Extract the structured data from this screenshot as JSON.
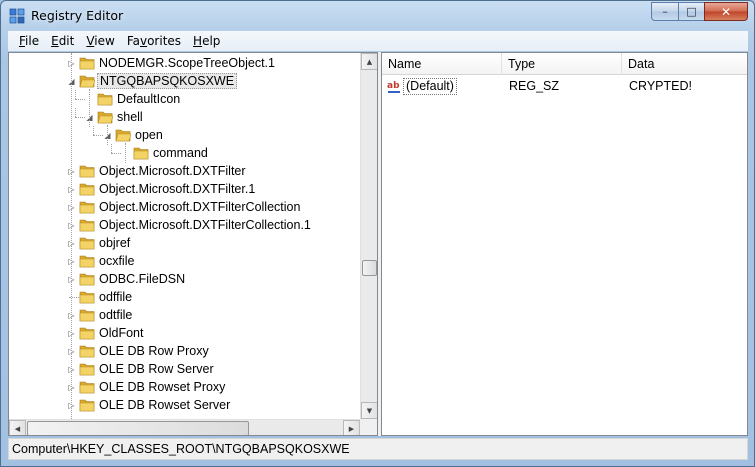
{
  "window": {
    "title": "Registry Editor",
    "icon": "registry-editor-icon",
    "buttons": {
      "minimize": "–",
      "maximize": "□",
      "close": "✕"
    }
  },
  "menu": [
    {
      "label_u": "F",
      "label_rest": "ile"
    },
    {
      "label_u": "E",
      "label_rest": "dit"
    },
    {
      "label_u": "V",
      "label_rest": "iew"
    },
    {
      "label_u": "F",
      "label_rest": "avorites",
      "prefix": "Fa",
      "u2": "v",
      "rest2": "orites"
    },
    {
      "label_u": "H",
      "label_rest": "elp"
    }
  ],
  "menu_labels": [
    "File",
    "Edit",
    "View",
    "Favorites",
    "Help"
  ],
  "tree": {
    "rows": [
      {
        "label": "NODEMGR.ScopeTreeObject.1",
        "level": 0,
        "expander": "collapsed"
      },
      {
        "label": "NTGQBAPSQKOSXWE",
        "level": 0,
        "expander": "expanded",
        "selected": true
      },
      {
        "label": "DefaultIcon",
        "level": 1,
        "expander": "none"
      },
      {
        "label": "shell",
        "level": 1,
        "expander": "expanded"
      },
      {
        "label": "open",
        "level": 2,
        "expander": "expanded"
      },
      {
        "label": "command",
        "level": 3,
        "expander": "none"
      },
      {
        "label": "Object.Microsoft.DXTFilter",
        "level": 0,
        "expander": "collapsed"
      },
      {
        "label": "Object.Microsoft.DXTFilter.1",
        "level": 0,
        "expander": "collapsed"
      },
      {
        "label": "Object.Microsoft.DXTFilterCollection",
        "level": 0,
        "expander": "collapsed"
      },
      {
        "label": "Object.Microsoft.DXTFilterCollection.1",
        "level": 0,
        "expander": "collapsed"
      },
      {
        "label": "objref",
        "level": 0,
        "expander": "collapsed"
      },
      {
        "label": "ocxfile",
        "level": 0,
        "expander": "collapsed"
      },
      {
        "label": "ODBC.FileDSN",
        "level": 0,
        "expander": "collapsed"
      },
      {
        "label": "odffile",
        "level": 0,
        "expander": "none"
      },
      {
        "label": "odtfile",
        "level": 0,
        "expander": "collapsed"
      },
      {
        "label": "OldFont",
        "level": 0,
        "expander": "collapsed"
      },
      {
        "label": "OLE DB Row Proxy",
        "level": 0,
        "expander": "collapsed"
      },
      {
        "label": "OLE DB Row Server",
        "level": 0,
        "expander": "collapsed"
      },
      {
        "label": "OLE DB Rowset Proxy",
        "level": 0,
        "expander": "collapsed"
      },
      {
        "label": "OLE DB Rowset Server",
        "level": 0,
        "expander": "collapsed"
      }
    ]
  },
  "list": {
    "columns": [
      "Name",
      "Type",
      "Data"
    ],
    "rows": [
      {
        "name": "(Default)",
        "type": "REG_SZ",
        "data": "CRYPTED!",
        "icon": "string-value-icon"
      }
    ]
  },
  "status": {
    "path": "Computer\\HKEY_CLASSES_ROOT\\NTGQBAPSQKOSXWE"
  },
  "colors": {
    "title_gradient_top": "#c9def3",
    "close_button": "#c0432a",
    "folder": "#e8c24a",
    "selection": "#e8e8e8"
  }
}
